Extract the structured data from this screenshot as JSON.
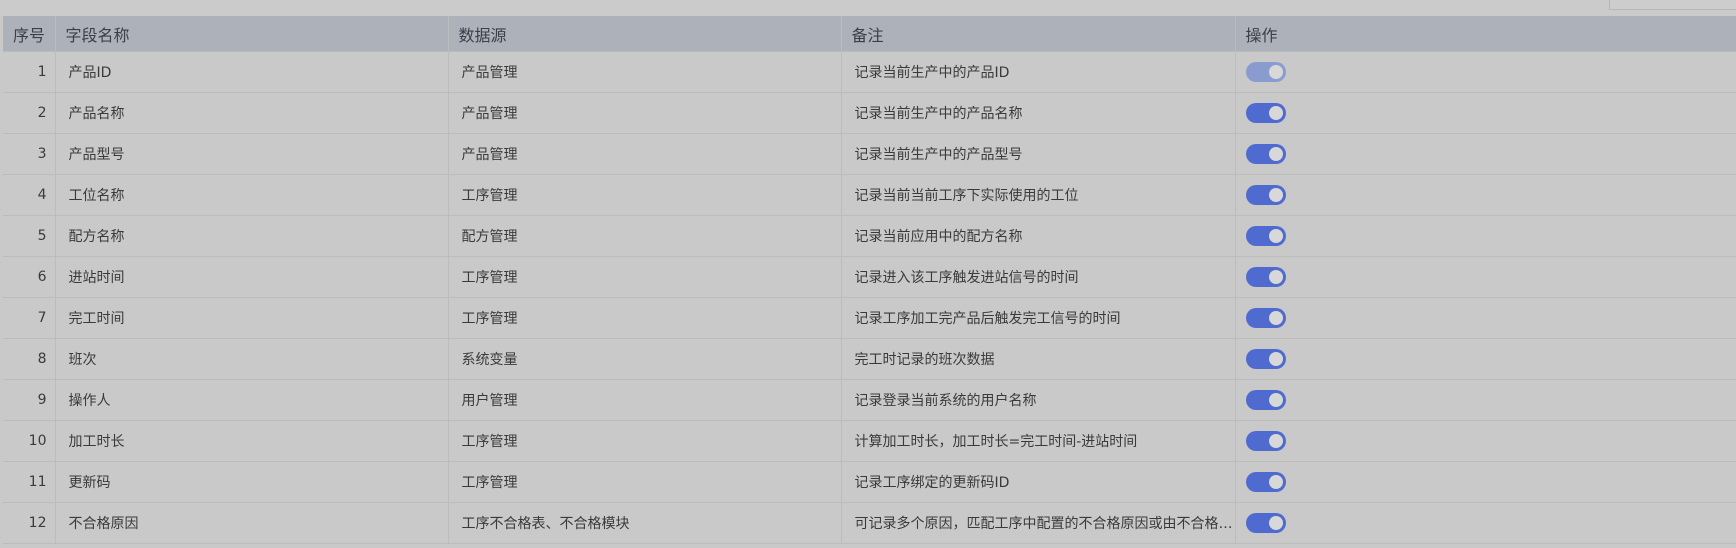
{
  "table": {
    "headers": {
      "index": "序号",
      "field_name": "字段名称",
      "data_source": "数据源",
      "remark": "备注",
      "action": "操作"
    },
    "rows": [
      {
        "index": "1",
        "field_name": "产品ID",
        "data_source": "产品管理",
        "remark": "记录当前生产中的产品ID",
        "enabled": true,
        "dimmed": true
      },
      {
        "index": "2",
        "field_name": "产品名称",
        "data_source": "产品管理",
        "remark": "记录当前生产中的产品名称",
        "enabled": true,
        "dimmed": false
      },
      {
        "index": "3",
        "field_name": "产品型号",
        "data_source": "产品管理",
        "remark": "记录当前生产中的产品型号",
        "enabled": true,
        "dimmed": false
      },
      {
        "index": "4",
        "field_name": "工位名称",
        "data_source": "工序管理",
        "remark": "记录当前当前工序下实际使用的工位",
        "enabled": true,
        "dimmed": false
      },
      {
        "index": "5",
        "field_name": "配方名称",
        "data_source": "配方管理",
        "remark": "记录当前应用中的配方名称",
        "enabled": true,
        "dimmed": false
      },
      {
        "index": "6",
        "field_name": "进站时间",
        "data_source": "工序管理",
        "remark": "记录进入该工序触发进站信号的时间",
        "enabled": true,
        "dimmed": false
      },
      {
        "index": "7",
        "field_name": "完工时间",
        "data_source": "工序管理",
        "remark": "记录工序加工完产品后触发完工信号的时间",
        "enabled": true,
        "dimmed": false
      },
      {
        "index": "8",
        "field_name": "班次",
        "data_source": "系统变量",
        "remark": "完工时记录的班次数据",
        "enabled": true,
        "dimmed": false
      },
      {
        "index": "9",
        "field_name": "操作人",
        "data_source": "用户管理",
        "remark": "记录登录当前系统的用户名称",
        "enabled": true,
        "dimmed": false
      },
      {
        "index": "10",
        "field_name": "加工时长",
        "data_source": "工序管理",
        "remark": "计算加工时长，加工时长=完工时间-进站时间",
        "enabled": true,
        "dimmed": false
      },
      {
        "index": "11",
        "field_name": "更新码",
        "data_source": "工序管理",
        "remark": "记录工序绑定的更新码ID",
        "enabled": true,
        "dimmed": false
      },
      {
        "index": "12",
        "field_name": "不合格原因",
        "data_source": "工序不合格表、不合格模块",
        "remark": "可记录多个原因，匹配工序中配置的不合格原因或由不合格品管理...",
        "enabled": true,
        "dimmed": false
      }
    ]
  },
  "colors": {
    "header_bg": "#adb1ba",
    "row_bg": "#c9c9c9",
    "switch_on": "#4f6bd0",
    "switch_dim": "#8a9bd0"
  },
  "icons": {
    "toggle": "toggle-switch-icon"
  }
}
